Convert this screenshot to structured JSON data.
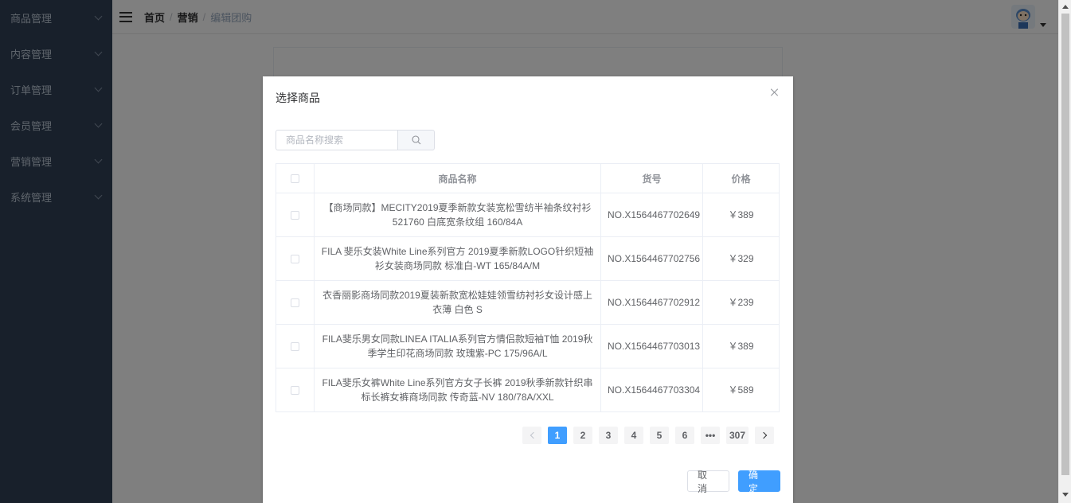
{
  "sidebar": {
    "items": [
      {
        "label": "商品管理"
      },
      {
        "label": "内容管理"
      },
      {
        "label": "订单管理"
      },
      {
        "label": "会员管理"
      },
      {
        "label": "营销管理"
      },
      {
        "label": "系统管理"
      }
    ]
  },
  "breadcrumb": {
    "home": "首页",
    "section": "营销",
    "current": "编辑团购",
    "separator": "/"
  },
  "dialog": {
    "title": "选择商品",
    "search_placeholder": "商品名称搜索",
    "columns": [
      "商品名称",
      "货号",
      "价格"
    ],
    "rows": [
      {
        "name": "【商场同款】MECITY2019夏季新款女装宽松雪纺半袖条纹衬衫521760 白底宽条纹组 160/84A",
        "sku": "NO.X1564467702649",
        "price": "￥389"
      },
      {
        "name": "FILA 斐乐女装White Line系列官方 2019夏季新款LOGO针织短袖衫女装商场同款 标准白-WT 165/84A/M",
        "sku": "NO.X1564467702756",
        "price": "￥329"
      },
      {
        "name": "衣香丽影商场同款2019夏装新款宽松娃娃领雪纺衬衫女设计感上衣薄 白色 S",
        "sku": "NO.X1564467702912",
        "price": "￥239"
      },
      {
        "name": "FILA斐乐男女同款LINEA ITALIA系列官方情侣款短袖T恤 2019秋季学生印花商场同款 玫瑰紫-PC 175/96A/L",
        "sku": "NO.X1564467703013",
        "price": "￥389"
      },
      {
        "name": "FILA斐乐女裤White Line系列官方女子长裤 2019秋季新款针织串标长裤女裤商场同款 传奇蓝-NV 180/78A/XXL",
        "sku": "NO.X1564467703304",
        "price": "￥589"
      }
    ],
    "pagination": {
      "pages": [
        "1",
        "2",
        "3",
        "4",
        "5",
        "6"
      ],
      "ellipsis": "•••",
      "last": "307",
      "current": 1
    },
    "cancel_label": "取 消",
    "confirm_label": "确 定"
  },
  "colors": {
    "sidebar_bg": "#304156",
    "primary": "#409eff"
  }
}
